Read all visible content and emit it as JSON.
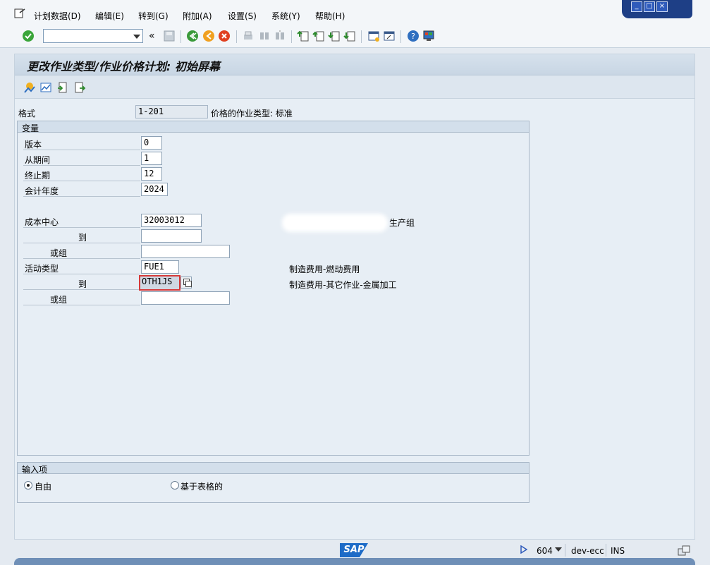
{
  "menu": {
    "items": [
      "计划数据(D)",
      "编辑(E)",
      "转到(G)",
      "附加(A)",
      "设置(S)",
      "系统(Y)",
      "帮助(H)"
    ]
  },
  "window_buttons": [
    "minimize-icon",
    "maximize-icon",
    "close-icon"
  ],
  "toolbar": {
    "command_value": "",
    "back_label": "«"
  },
  "screen": {
    "title": "更改作业类型/作业价格计划: 初始屏幕"
  },
  "layout_row": {
    "label": "格式",
    "value": "1-201",
    "description": "价格的作业类型: 标准"
  },
  "variables_group": {
    "title": "变量",
    "version_label": "版本",
    "version_value": "0",
    "from_period_label": "从期间",
    "from_period_value": "1",
    "to_period_label": "终止期",
    "to_period_value": "12",
    "fiscal_year_label": "会计年度",
    "fiscal_year_value": "2024",
    "cost_center_label": "成本中心",
    "cost_center_value": "32003012",
    "cost_center_desc": "生产组",
    "cost_center_to_label": "到",
    "cost_center_to_value": "",
    "cost_center_group_label": "或组",
    "cost_center_group_value": "",
    "activity_type_label": "活动类型",
    "activity_type_value": "FUE1",
    "activity_type_desc": "制造费用-燃动费用",
    "activity_type_to_label": "到",
    "activity_type_to_value": "OTH1JS",
    "activity_type_to_desc": "制造费用-其它作业-金属加工",
    "activity_type_group_label": "或组",
    "activity_type_group_value": ""
  },
  "entry_group": {
    "title": "输入项",
    "free_label": "自由",
    "form_label": "基于表格的",
    "selected": "free"
  },
  "status": {
    "client": "604",
    "system": "dev-ecc",
    "mode": "INS"
  },
  "colors": {
    "accent": "#1e3f86",
    "focus_border": "#d63a3a",
    "background": "#e4eaf1"
  }
}
